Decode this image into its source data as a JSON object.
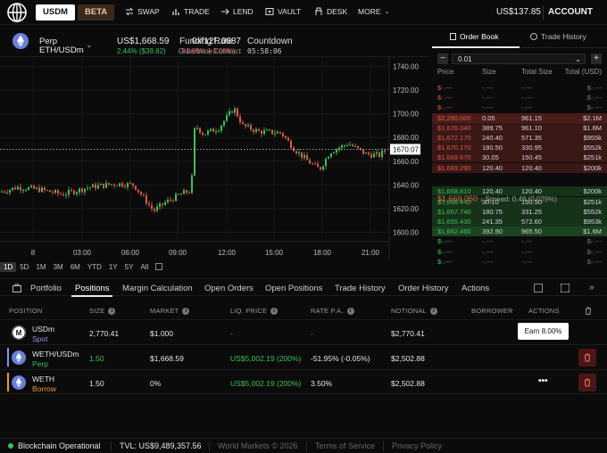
{
  "nav": {
    "usdm": "USDM",
    "beta": "BETA",
    "links": [
      "SWAP",
      "TRADE",
      "LEND",
      "VAULT",
      "DESK",
      "MORE"
    ],
    "balance": "US$137.85",
    "account": "ACCOUNT"
  },
  "market": {
    "pair_line1": "Perp",
    "pair_line2": "ETH/USDm",
    "price": "US$1,668.59",
    "change": "2.44% ($39.82)",
    "funding_label": "Funding Rate",
    "funding_value": "-51.95% (-0.05%)",
    "countdown_label": "Countdown",
    "countdown_value": "05:58:06",
    "contract_address": "0xf12f..0687",
    "contract_label": "Orderbook Contract"
  },
  "chart_data": {
    "type": "candlestick",
    "y_ticks": [
      "1740.00",
      "1720.00",
      "1700.00",
      "1680.00",
      "1670.07",
      "1660.00",
      "1640.00",
      "1620.00",
      "1600.00"
    ],
    "x_ticks": [
      "8",
      "03:00",
      "06:00",
      "09:00",
      "12:00",
      "15:00",
      "18:00",
      "21:00"
    ],
    "ylim": [
      1592,
      1748
    ],
    "last_price": 1670.07,
    "colors": {
      "up": "#3fbf5a",
      "down": "#e0564a"
    }
  },
  "timeframes": [
    "1D",
    "5D",
    "1M",
    "3M",
    "6M",
    "YTD",
    "1Y",
    "5Y",
    "All"
  ],
  "orderbook": {
    "tab_book": "Order Book",
    "tab_history": "Trade History",
    "tick": "0.01",
    "headers": [
      "Price",
      "Size",
      "Total Size",
      "Total (USD)"
    ],
    "asks_empty": [
      [
        "$-.---",
        "-.---",
        "-.---",
        "$-.---"
      ],
      [
        "$-.---",
        "-.---",
        "-.---",
        "$-.---"
      ],
      [
        "$-.---",
        "-.---",
        "-.---",
        "$-.---"
      ]
    ],
    "asks": [
      [
        "$2,280.000",
        "0.05",
        "961.15",
        "$2.1M"
      ],
      [
        "$1,676.040",
        "389.75",
        "961.10",
        "$1.6M"
      ],
      [
        "$1,672.170",
        "240.40",
        "571.35",
        "$955k"
      ],
      [
        "$1,670.170",
        "180.50",
        "330.95",
        "$552k"
      ],
      [
        "$1,669.670",
        "30.05",
        "150.45",
        "$251k"
      ],
      [
        "$1,669.290",
        "120.40",
        "120.40",
        "$200k"
      ]
    ],
    "spread_price": "$1,669.050",
    "spread_text": "↓ Spread: 0.48 (0.029%)",
    "bids": [
      [
        "$1,668.810",
        "120.40",
        "120.40",
        "$200k"
      ],
      [
        "$1,668.440",
        "30.10",
        "150.50",
        "$251k"
      ],
      [
        "$1,667.740",
        "180.75",
        "331.25",
        "$552k"
      ],
      [
        "$1,665.430",
        "241.35",
        "572.60",
        "$953k"
      ],
      [
        "$1,662.460",
        "392.90",
        "965.50",
        "$1.6M"
      ]
    ],
    "bids_empty": [
      [
        "$-.---",
        "-.---",
        "-.---",
        "$-.---"
      ],
      [
        "$-.---",
        "-.---",
        "-.---",
        "$-.---"
      ],
      [
        "$-.---",
        "-.---",
        "-.---",
        "$-.---"
      ]
    ]
  },
  "bottom_tabs": [
    "Portfolio",
    "Positions",
    "Margin Calculation",
    "Open Orders",
    "Open Positions",
    "Trade History",
    "Order History",
    "Actions"
  ],
  "positions": {
    "headers": [
      "POSITION",
      "SIZE",
      "MARKET",
      "LIQ. PRICE",
      "RATE P.A.",
      "NOTIONAL",
      "BORROWER",
      "ACTIONS"
    ],
    "rows": [
      {
        "name": "USDm",
        "sub": "Spot",
        "size": "2,770.41",
        "market": "$1.000",
        "liq": "-",
        "rate": "-",
        "notional": "$2,770.41",
        "action": "Earn 8.00%"
      },
      {
        "name": "WETH/USDm",
        "sub": "Perp",
        "size": "1.50",
        "market": "$1,668.59",
        "liq": "US$5,002.19 (200%)",
        "rate": "-51.95% (-0.05%)",
        "notional": "$2,502.88",
        "action": ""
      },
      {
        "name": "WETH",
        "sub": "Borrow",
        "size": "1.50",
        "market": "0%",
        "liq": "US$5,002.19 (200%)",
        "rate": "3.50%",
        "notional": "$2,502.88",
        "action": "•••"
      }
    ]
  },
  "footer": {
    "status": "Blockchain Operational",
    "tvl": "TVL: US$9,489,357.56",
    "links": [
      "World Markets © 2026",
      "Terms of Service",
      "Privacy Policy"
    ]
  }
}
